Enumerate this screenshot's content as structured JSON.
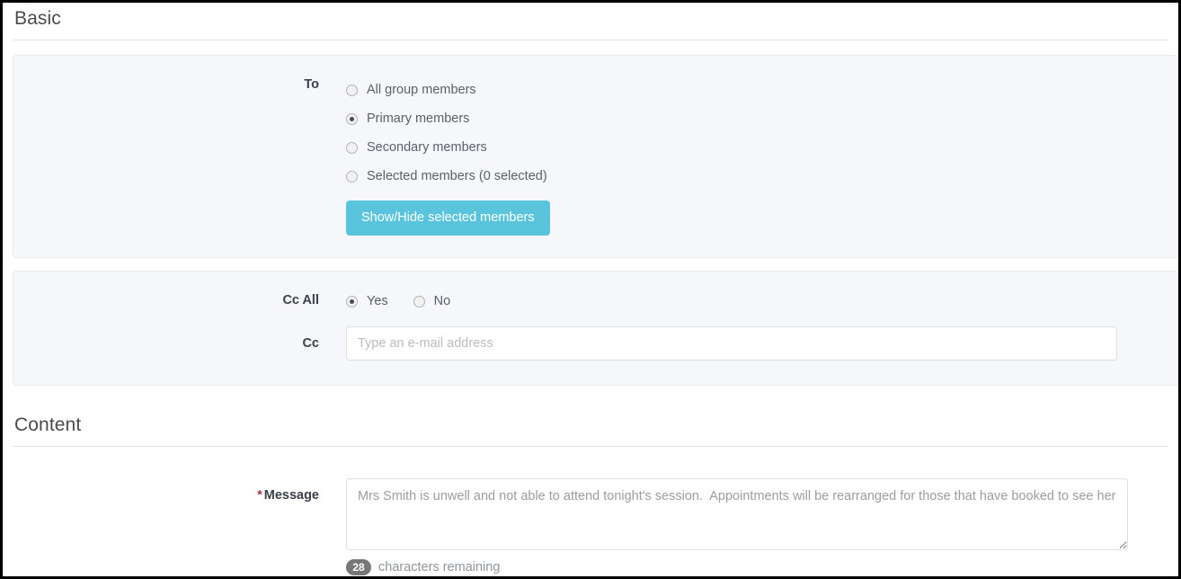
{
  "sections": {
    "basic": {
      "title": "Basic"
    },
    "content": {
      "title": "Content"
    }
  },
  "to_group": {
    "label": "To",
    "options": [
      {
        "label": "All group members",
        "checked": false
      },
      {
        "label": "Primary members",
        "checked": true
      },
      {
        "label": "Secondary members",
        "checked": false
      },
      {
        "label": "Selected members (0 selected)",
        "checked": false
      }
    ],
    "show_hide_button": "Show/Hide selected members",
    "button_color": "#5bc4dd"
  },
  "cc_all": {
    "label": "Cc All",
    "options": [
      {
        "label": "Yes",
        "checked": true
      },
      {
        "label": "No",
        "checked": false
      }
    ]
  },
  "cc": {
    "label": "Cc",
    "value": "",
    "placeholder": "Type an e-mail address"
  },
  "message": {
    "label": "Message",
    "required_marker": "*",
    "required_marker_color": "#a94442",
    "value": "Mrs Smith is unwell and not able to attend tonight's session.  Appointments will be rearranged for those that have booked to see her",
    "counter_badge": "28",
    "counter_text": "characters remaining"
  }
}
